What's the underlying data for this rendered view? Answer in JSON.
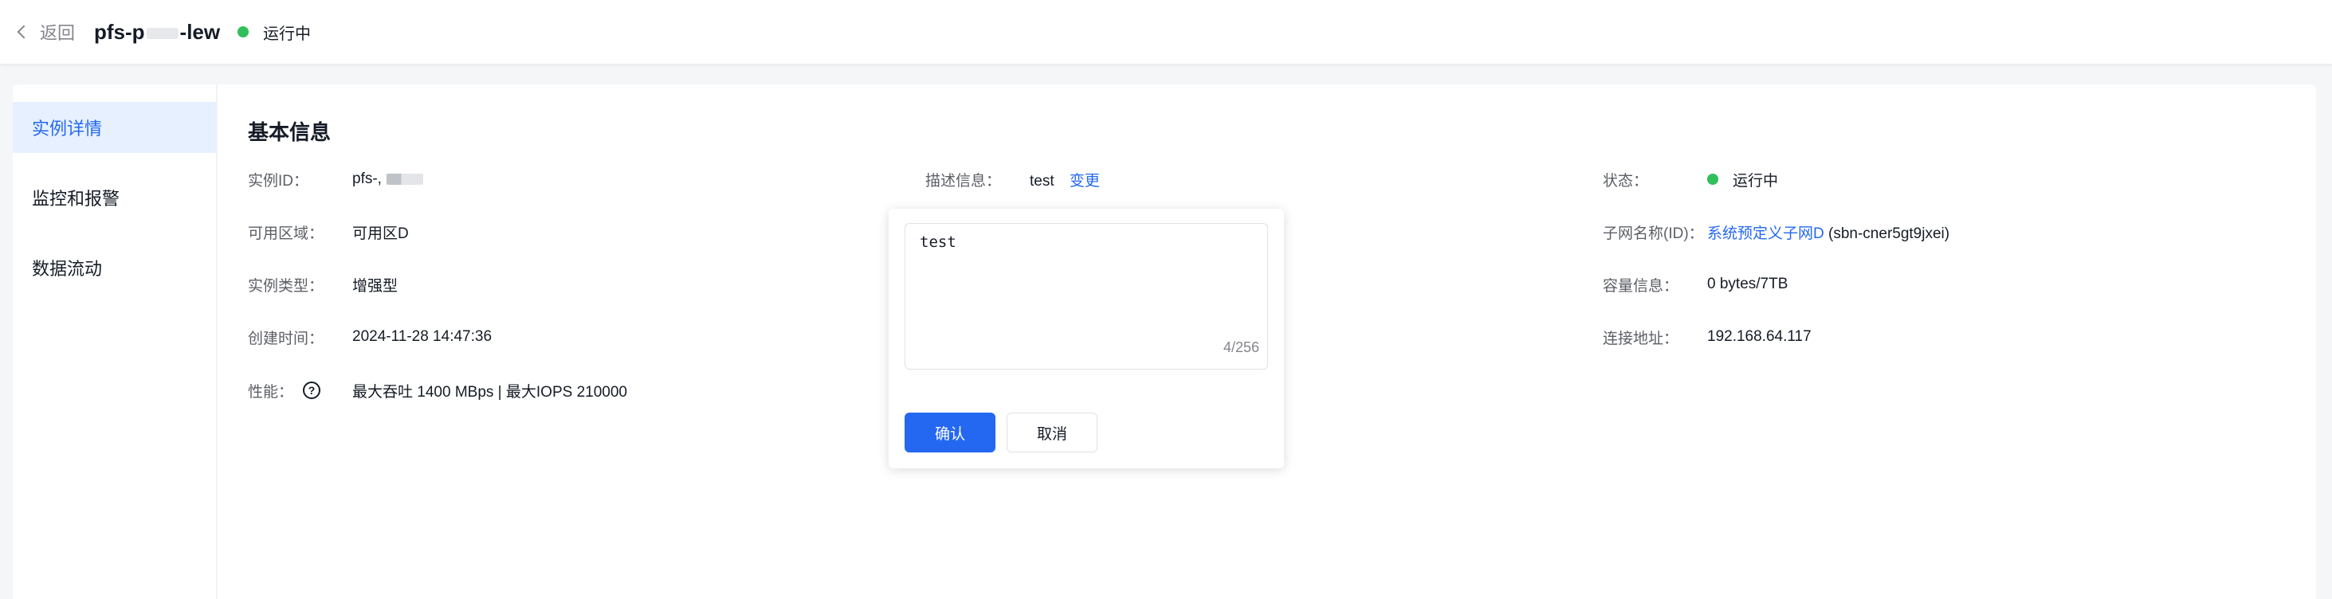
{
  "header": {
    "back_label": "返回",
    "title_prefix": "pfs-p",
    "title_suffix": "-lew",
    "status": "运行中"
  },
  "sidebar": {
    "items": [
      {
        "label": "实例详情",
        "active": true
      },
      {
        "label": "监控和报警",
        "active": false
      },
      {
        "label": "数据流动",
        "active": false
      }
    ]
  },
  "section": {
    "title": "基本信息"
  },
  "fields": {
    "instance_id": {
      "label": "实例ID：",
      "value": "pfs-,"
    },
    "zone": {
      "label": "可用区域：",
      "value": "可用区D"
    },
    "instance_type": {
      "label": "实例类型：",
      "value": "增强型"
    },
    "created": {
      "label": "创建时间：",
      "value": "2024-11-28 14:47:36"
    },
    "performance": {
      "label": "性能：",
      "value": "最大吞吐 1400 MBps | 最大IOPS 210000"
    },
    "description": {
      "label": "描述信息：",
      "value": "test",
      "action": "变更"
    },
    "status": {
      "label": "状态：",
      "value": "运行中"
    },
    "subnet": {
      "label": "子网名称(ID)：",
      "link": "系统预定义子网D",
      "id": "(sbn-cner5gt9jxei)"
    },
    "capacity": {
      "label": "容量信息：",
      "value": "0 bytes/7TB"
    },
    "address": {
      "label": "连接地址：",
      "value": "192.168.64.117"
    }
  },
  "popover": {
    "textarea_value": "test",
    "counter": "4/256",
    "confirm_label": "确认",
    "cancel_label": "取消"
  },
  "colors": {
    "accent": "#2468f2",
    "status_green": "#30bf5a",
    "sidebar_active_bg": "#e6f0ff"
  }
}
